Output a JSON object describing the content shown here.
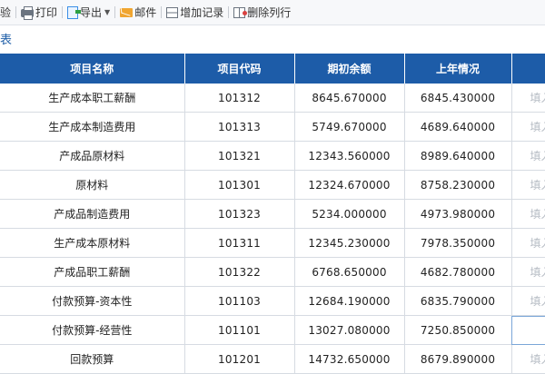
{
  "toolbar": {
    "check_label": "验",
    "print_label": "打印",
    "export_label": "导出",
    "mail_label": "邮件",
    "add_record_label": "增加记录",
    "delete_column_label": "删除列行"
  },
  "section_title": "表",
  "table": {
    "headers": [
      "项目名称",
      "项目代码",
      "期初余额",
      "上年情况",
      ""
    ],
    "fill_placeholder": "填入",
    "rows": [
      {
        "name": "生产成本职工薪酬",
        "code": "101312",
        "opening": "8645.670000",
        "last_year": "6845.430000",
        "extra": "填入"
      },
      {
        "name": "生产成本制造费用",
        "code": "101313",
        "opening": "5749.670000",
        "last_year": "4689.640000",
        "extra": "填入"
      },
      {
        "name": "产成品原材料",
        "code": "101321",
        "opening": "12343.560000",
        "last_year": "8989.640000",
        "extra": "填入"
      },
      {
        "name": "原材料",
        "code": "101301",
        "opening": "12324.670000",
        "last_year": "8758.230000",
        "extra": "填入"
      },
      {
        "name": "产成品制造费用",
        "code": "101323",
        "opening": "5234.000000",
        "last_year": "4973.980000",
        "extra": "填入"
      },
      {
        "name": "生产成本原材料",
        "code": "101311",
        "opening": "12345.230000",
        "last_year": "7978.350000",
        "extra": "填入"
      },
      {
        "name": "产成品职工薪酬",
        "code": "101322",
        "opening": "6768.650000",
        "last_year": "4682.780000",
        "extra": "填入"
      },
      {
        "name": "付款预算-资本性",
        "code": "101103",
        "opening": "12684.190000",
        "last_year": "6835.790000",
        "extra": "填入"
      },
      {
        "name": "付款预算-经营性",
        "code": "101101",
        "opening": "13027.080000",
        "last_year": "7250.850000",
        "extra": ""
      },
      {
        "name": "回款预算",
        "code": "101201",
        "opening": "14732.650000",
        "last_year": "8679.890000",
        "extra": "填入"
      }
    ]
  }
}
